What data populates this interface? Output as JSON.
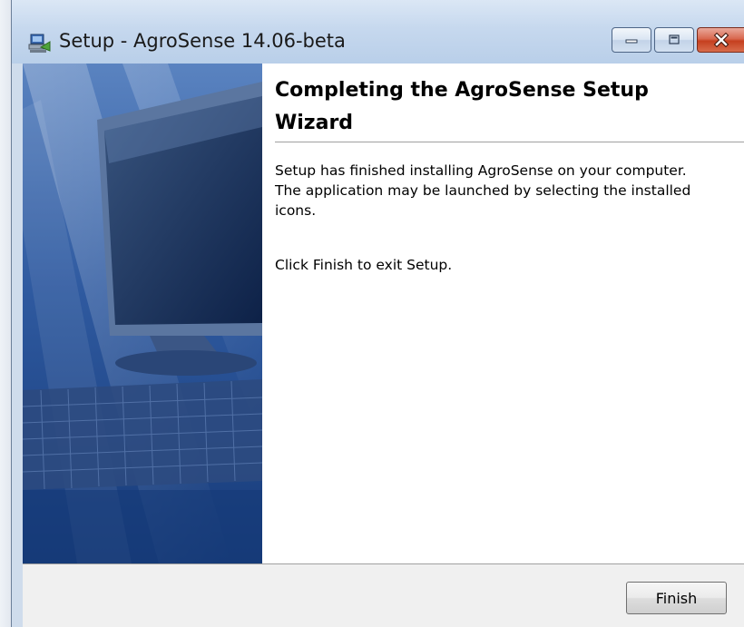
{
  "window": {
    "title": "Setup - AgroSense 14.06-beta",
    "icon": "setup-installer-icon",
    "controls": {
      "minimize": "minimize-icon",
      "maximize": "maximize-icon",
      "close": "close-icon"
    }
  },
  "wizard": {
    "image": "computer-monitor-keyboard-illustration",
    "heading": "Completing the AgroSense Setup Wizard",
    "paragraph1": "Setup has finished installing AgroSense on your computer. The application may be launched by selecting the installed icons.",
    "paragraph2": "Click Finish to exit Setup."
  },
  "buttons": {
    "finish_label": "Finish"
  },
  "colors": {
    "titlebar": "#c6d8ee",
    "close_button": "#c5401f",
    "wizard_image_blue": "#1b3f7a"
  }
}
